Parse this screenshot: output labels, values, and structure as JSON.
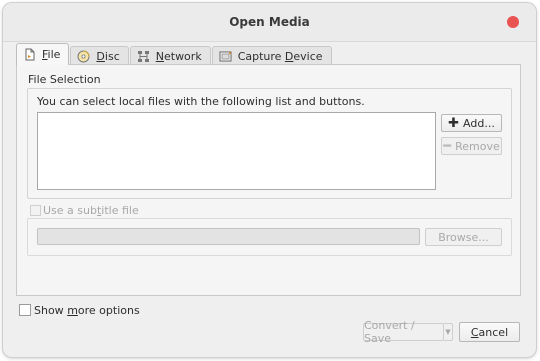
{
  "window": {
    "title": "Open Media"
  },
  "tabs": [
    {
      "label": "File",
      "mnemonic": "F",
      "rest": "ile",
      "icon": "file-icon"
    },
    {
      "label": "Disc",
      "mnemonic": "D",
      "rest": "isc",
      "icon": "disc-icon"
    },
    {
      "label": "Network",
      "mnemonic": "N",
      "rest": "etwork",
      "icon": "network-icon"
    },
    {
      "label": "Capture Device",
      "pre": "Capture ",
      "mnemonic": "D",
      "rest": "evice",
      "icon": "capture-device-icon"
    }
  ],
  "file_selection": {
    "title": "File Selection",
    "hint": "You can select local files with the following list and buttons.",
    "add_label": "Add...",
    "remove_label": "Remove"
  },
  "subtitle": {
    "checkbox_label_pre": "Use a sub",
    "checkbox_label_mn": "t",
    "checkbox_label_post": "itle file",
    "browse_label": "Browse..."
  },
  "footer": {
    "show_more_pre": "Show ",
    "show_more_mn": "m",
    "show_more_post": "ore options",
    "convert_label": "Convert / Save",
    "cancel_pre": "",
    "cancel_mn": "C",
    "cancel_post": "ancel"
  },
  "colors": {
    "close_button": "#e95453"
  }
}
